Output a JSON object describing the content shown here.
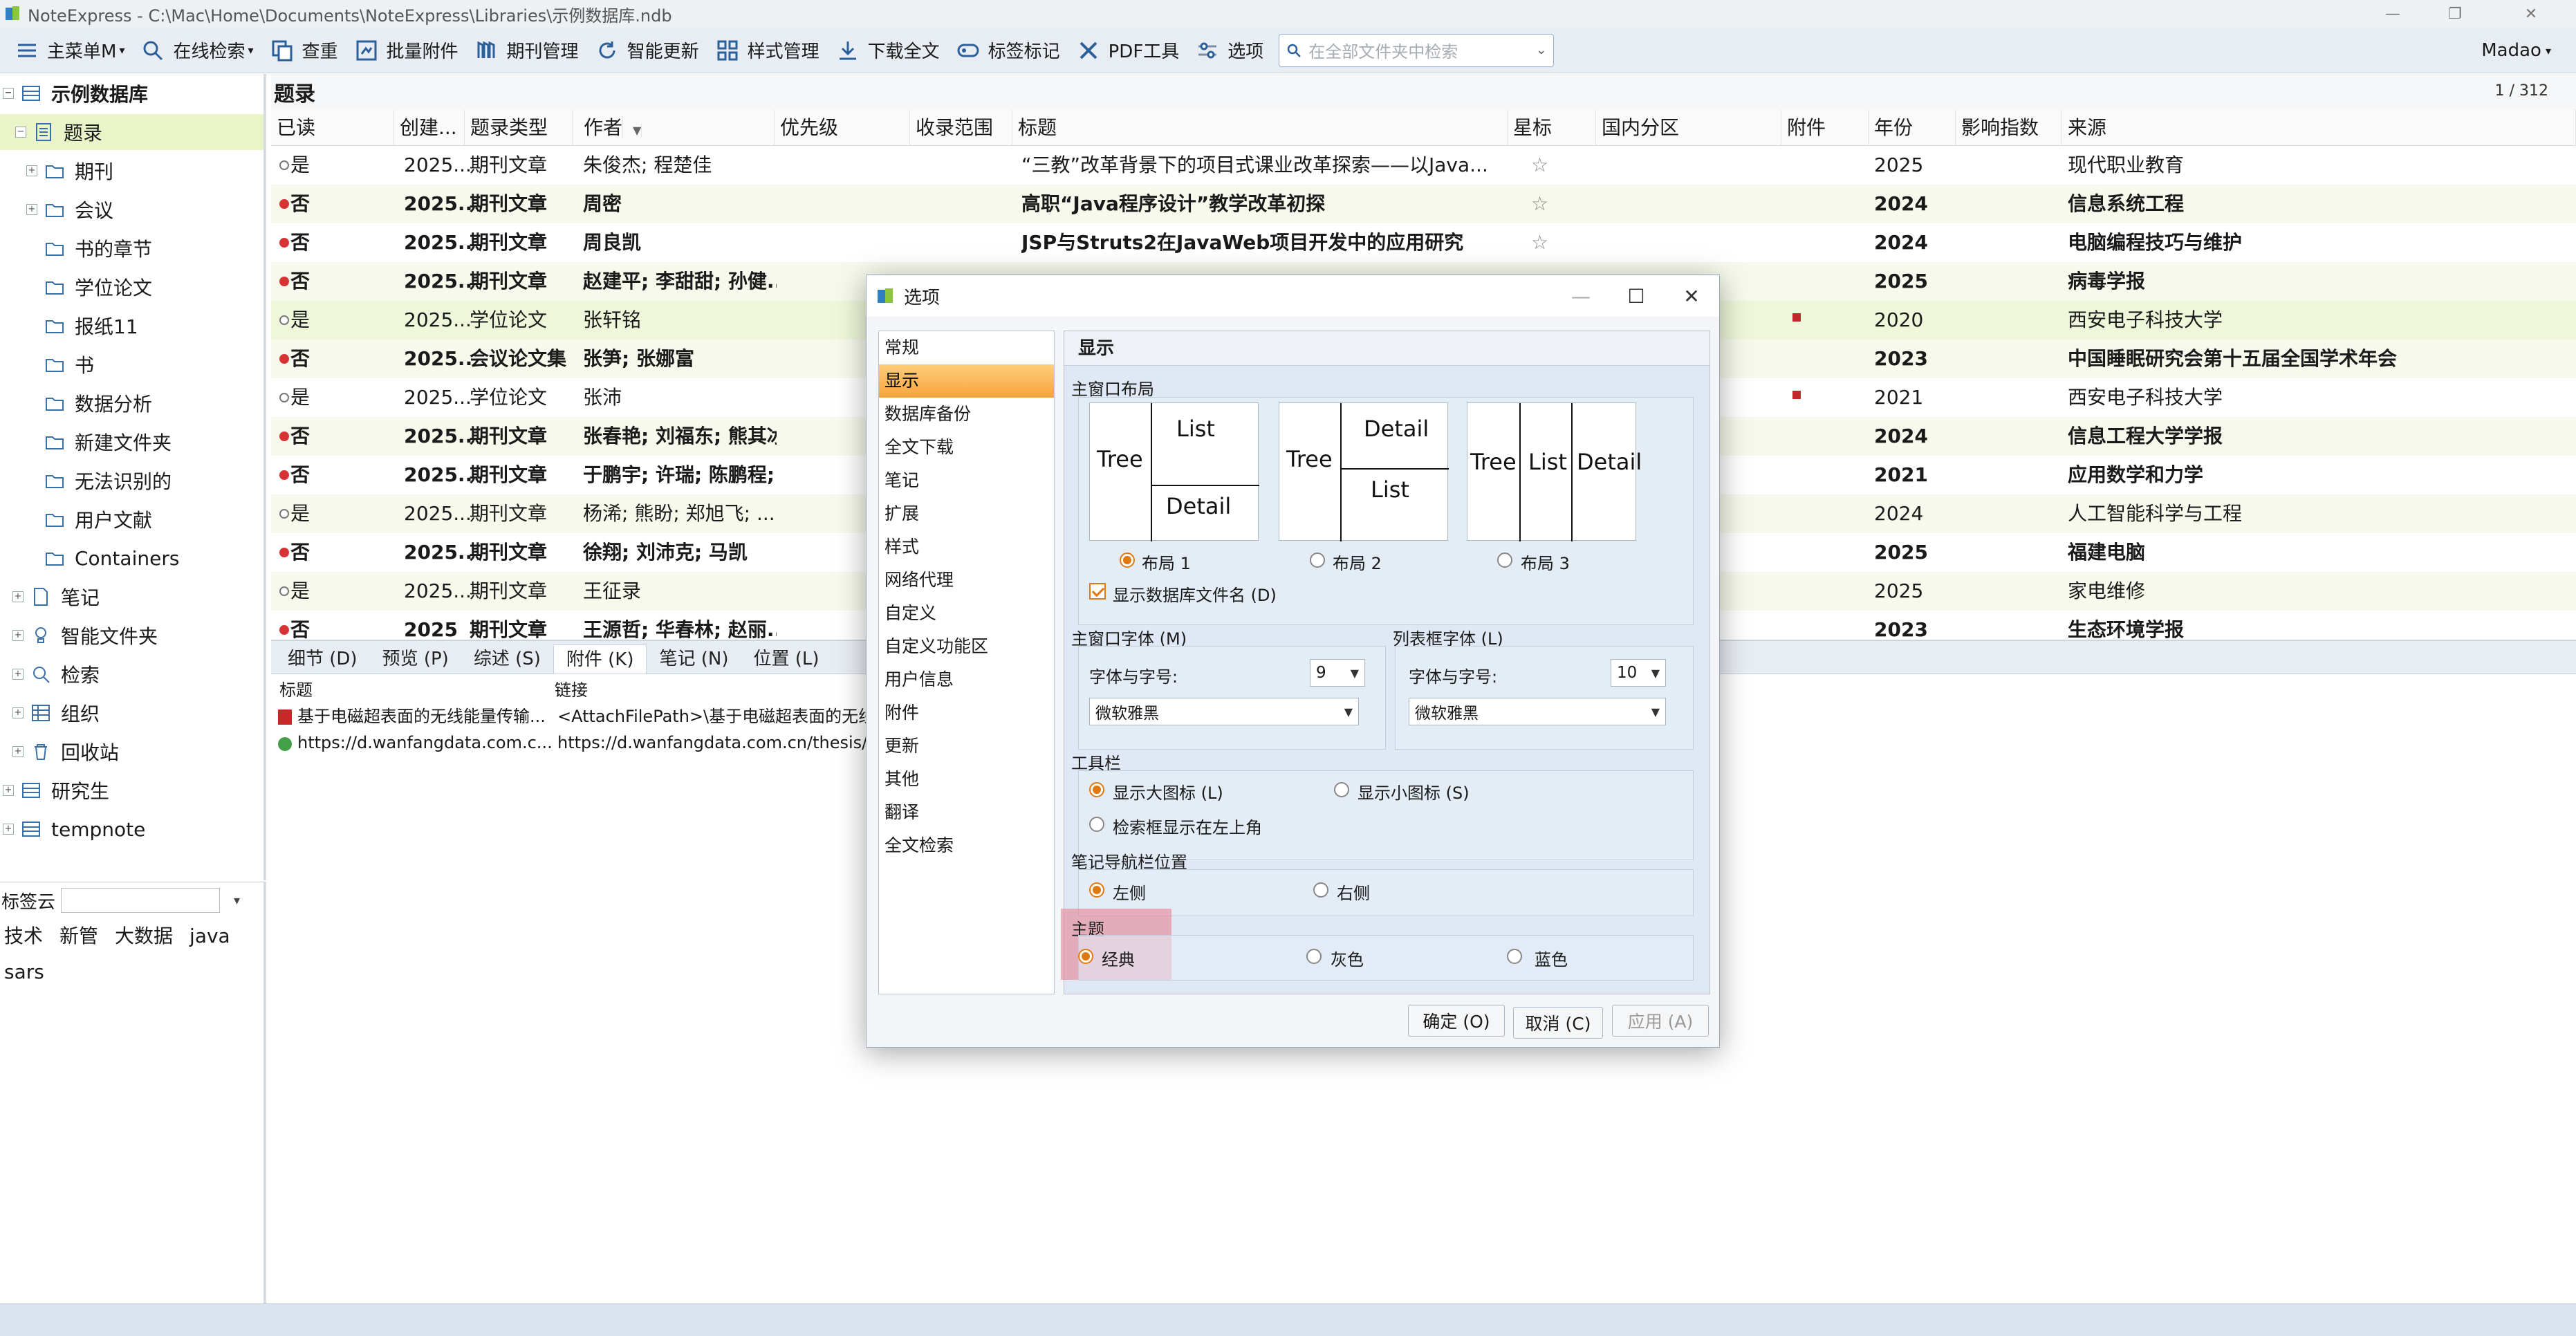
{
  "window": {
    "title": "NoteExpress - C:\\Mac\\Home\\Documents\\NoteExpress\\Libraries\\示例数据库.ndb",
    "user": "Madao"
  },
  "toolbar": {
    "items": [
      {
        "label": "主菜单M",
        "icon": "menu-icon"
      },
      {
        "label": "在线检索",
        "icon": "search-icon"
      },
      {
        "label": "查重",
        "icon": "duplicate-icon"
      },
      {
        "label": "批量附件",
        "icon": "attachment-icon"
      },
      {
        "label": "期刊管理",
        "icon": "journal-icon"
      },
      {
        "label": "智能更新",
        "icon": "refresh-icon"
      },
      {
        "label": "样式管理",
        "icon": "style-icon"
      },
      {
        "label": "下载全文",
        "icon": "download-icon"
      },
      {
        "label": "标签标记",
        "icon": "tag-icon"
      },
      {
        "label": "PDF工具",
        "icon": "pdf-tool-icon"
      },
      {
        "label": "选项",
        "icon": "options-icon"
      }
    ],
    "search_placeholder": "在全部文件夹中检索"
  },
  "tree": {
    "items": [
      {
        "label": "示例数据库"
      },
      {
        "label": "题录"
      },
      {
        "label": "期刊"
      },
      {
        "label": "会议"
      },
      {
        "label": "书的章节"
      },
      {
        "label": "学位论文"
      },
      {
        "label": "报纸11"
      },
      {
        "label": "书"
      },
      {
        "label": "数据分析"
      },
      {
        "label": "新建文件夹"
      },
      {
        "label": "无法识别的"
      },
      {
        "label": "用户文献"
      },
      {
        "label": "Containers"
      },
      {
        "label": "笔记"
      },
      {
        "label": "智能文件夹"
      },
      {
        "label": "检索"
      },
      {
        "label": "组织"
      },
      {
        "label": "回收站"
      },
      {
        "label": "研究生"
      },
      {
        "label": "tempnote"
      }
    ]
  },
  "tagcloud": {
    "title": "标签云",
    "tags": [
      "技术",
      "新管",
      "大数据",
      "java",
      "sars"
    ]
  },
  "list": {
    "title": "题录",
    "page": "1 / 312",
    "columns": [
      "已读",
      "创建...",
      "题录类型",
      "作者",
      "优先级",
      "收录范围",
      "标题",
      "星标",
      "国内分区",
      "附件",
      "年份",
      "影响指数",
      "来源"
    ],
    "rows": [
      {
        "read": "是",
        "created": "2025...",
        "type": "期刊文章",
        "author": "朱俊杰; 程楚佳",
        "title": "“三教”改革背景下的项目式课业改革探索——以Java...",
        "year": "2025",
        "source": "现代职业教育"
      },
      {
        "read": "否",
        "created": "2025...",
        "type": "期刊文章",
        "author": "周密",
        "title": "高职“Java程序设计”教学改革初探",
        "year": "2024",
        "source": "信息系统工程"
      },
      {
        "read": "否",
        "created": "2025...",
        "type": "期刊文章",
        "author": "周良凯",
        "title": "JSP与Struts2在JavaWeb项目开发中的应用研究",
        "year": "2024",
        "source": "电脑编程技巧与维护"
      },
      {
        "read": "否",
        "created": "2025...",
        "type": "期刊文章",
        "author": "赵建平; 李甜甜; 孙健...",
        "title": "",
        "year": "2025",
        "source": "病毒学报"
      },
      {
        "read": "是",
        "created": "2025...",
        "type": "学位论文",
        "author": "张轩铭",
        "title": "",
        "year": "2020",
        "source": "西安电子科技大学"
      },
      {
        "read": "否",
        "created": "2025...",
        "type": "会议论文集",
        "author": "张笋; 张娜富",
        "title": "",
        "year": "2023",
        "source": "中国睡眠研究会第十五届全国学术年会"
      },
      {
        "read": "是",
        "created": "2025...",
        "type": "学位论文",
        "author": "张沛",
        "title": "",
        "year": "2021",
        "source": "西安电子科技大学"
      },
      {
        "read": "否",
        "created": "2025...",
        "type": "期刊文章",
        "author": "张春艳; 刘福东; 熊其冰",
        "title": "",
        "year": "2024",
        "source": "信息工程大学学报"
      },
      {
        "read": "否",
        "created": "2025...",
        "type": "期刊文章",
        "author": "于鹏宇; 许瑞; 陈鹏程;...",
        "title": "",
        "year": "2021",
        "source": "应用数学和力学"
      },
      {
        "read": "是",
        "created": "2025...",
        "type": "期刊文章",
        "author": "杨浠; 熊盼; 郑旭飞; ...",
        "title": "",
        "year": "2024",
        "source": "人工智能科学与工程"
      },
      {
        "read": "否",
        "created": "2025...",
        "type": "期刊文章",
        "author": "徐翔; 刘沛克; 马凯",
        "title": "",
        "year": "2025",
        "source": "福建电脑"
      },
      {
        "read": "是",
        "created": "2025...",
        "type": "期刊文章",
        "author": "王征录",
        "title": "",
        "year": "2025",
        "source": "家电维修"
      },
      {
        "read": "否",
        "created": "2025",
        "type": "期刊文章",
        "author": "王源哲; 华春林; 赵丽...",
        "title": "",
        "year": "2023",
        "source": "生态环境学报"
      }
    ]
  },
  "bottom": {
    "tabs": [
      "细节 (D)",
      "预览 (P)",
      "综述 (S)",
      "附件 (K)",
      "笔记 (N)",
      "位置 (L)"
    ],
    "col_title": "标题",
    "col_link": "链接",
    "rows": [
      {
        "title": "基于电磁超表面的无线能量传输...",
        "link": "<AttachFilePath>\\基于电磁超表面的无线"
      },
      {
        "title": "https://d.wanfangdata.com.c...",
        "link": "https://d.wanfangdata.com.cn/thesis/C"
      }
    ]
  },
  "dialog": {
    "title": "选项",
    "nav": [
      "常规",
      "显示",
      "数据库备份",
      "全文下载",
      "笔记",
      "扩展",
      "样式",
      "网络代理",
      "自定义",
      "自定义功能区",
      "用户信息",
      "附件",
      "更新",
      "其他",
      "翻译",
      "全文检索"
    ],
    "panel_title": "显示",
    "layout_group": "主窗口布局",
    "layout_words": {
      "tree": "Tree",
      "list": "List",
      "detail": "Detail"
    },
    "layouts": [
      "布局 1",
      "布局 2",
      "布局 3"
    ],
    "show_db_filename": "显示数据库文件名 (D)",
    "main_font_group": "主窗口字体 (M)",
    "list_font_group": "列表框字体 (L)",
    "font_size_label": "字体与字号:",
    "main_font_size": "9",
    "list_font_size": "10",
    "main_font": "微软雅黑",
    "list_font": "微软雅黑",
    "toolbar_group": "工具栏",
    "large_icons": "显示大图标 (L)",
    "small_icons": "显示小图标 (S)",
    "search_top_left": "检索框显示在左上角",
    "note_nav_group": "笔记导航栏位置",
    "left": "左侧",
    "right": "右侧",
    "theme_group": "主题",
    "themes": [
      "经典",
      "灰色",
      "蓝色"
    ],
    "ok": "确定 (O)",
    "cancel": "取消 (C)",
    "apply": "应用 (A)"
  }
}
